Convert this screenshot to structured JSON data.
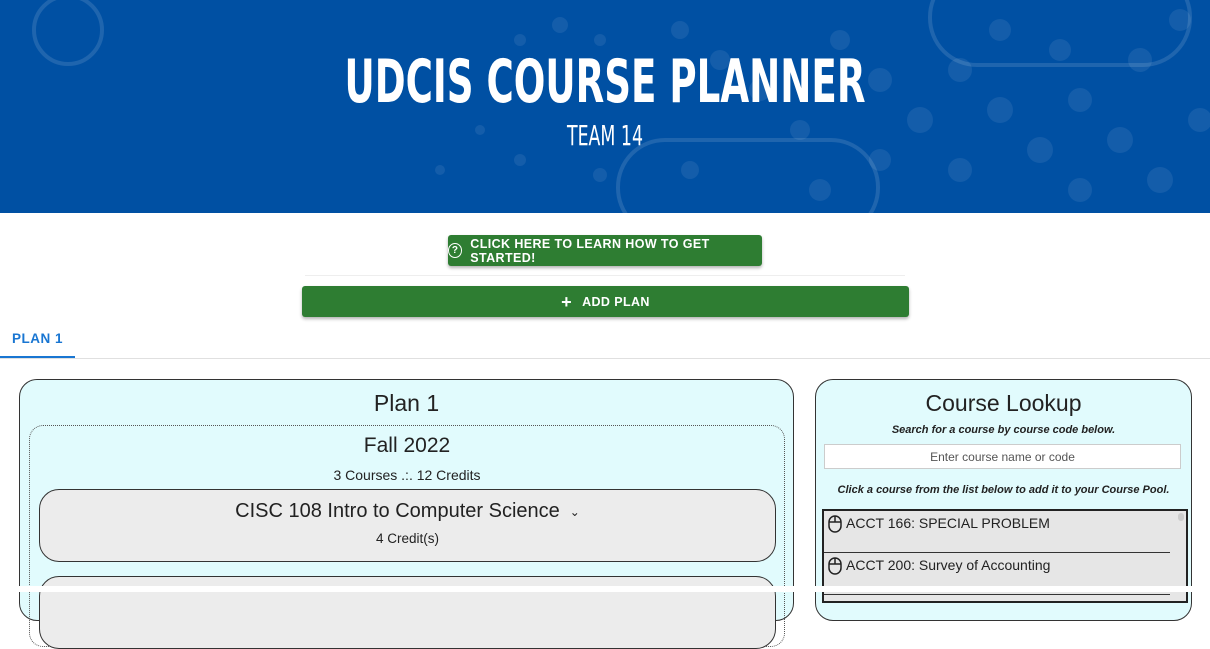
{
  "header": {
    "title": "UDCIS COURSE PLANNER",
    "subtitle": "TEAM 14"
  },
  "buttons": {
    "help_label": "CLICK HERE TO LEARN HOW TO GET STARTED!",
    "add_plan_label": "ADD PLAN"
  },
  "tabs": [
    {
      "label": "PLAN 1",
      "active": true
    }
  ],
  "plan": {
    "title": "Plan 1",
    "semesters": [
      {
        "title": "Fall 2022",
        "info": "3 Courses .:. 12 Credits",
        "courses": [
          {
            "name": "CISC 108 Intro to Computer Science",
            "credits": "4 Credit(s)"
          }
        ]
      }
    ]
  },
  "lookup": {
    "title": "Course Lookup",
    "description": "Search for a course by course code below.",
    "search_placeholder": "Enter course name or code",
    "hint": "Click a course from the list below to add it to your Course Pool.",
    "courses": [
      {
        "label": "ACCT 166: SPECIAL PROBLEM"
      },
      {
        "label": "ACCT 200: Survey of Accounting"
      }
    ]
  },
  "colors": {
    "banner": "#0050a3",
    "button": "#2e7d32",
    "tab_active": "#1976d2",
    "panel": "#e1fbfd"
  }
}
